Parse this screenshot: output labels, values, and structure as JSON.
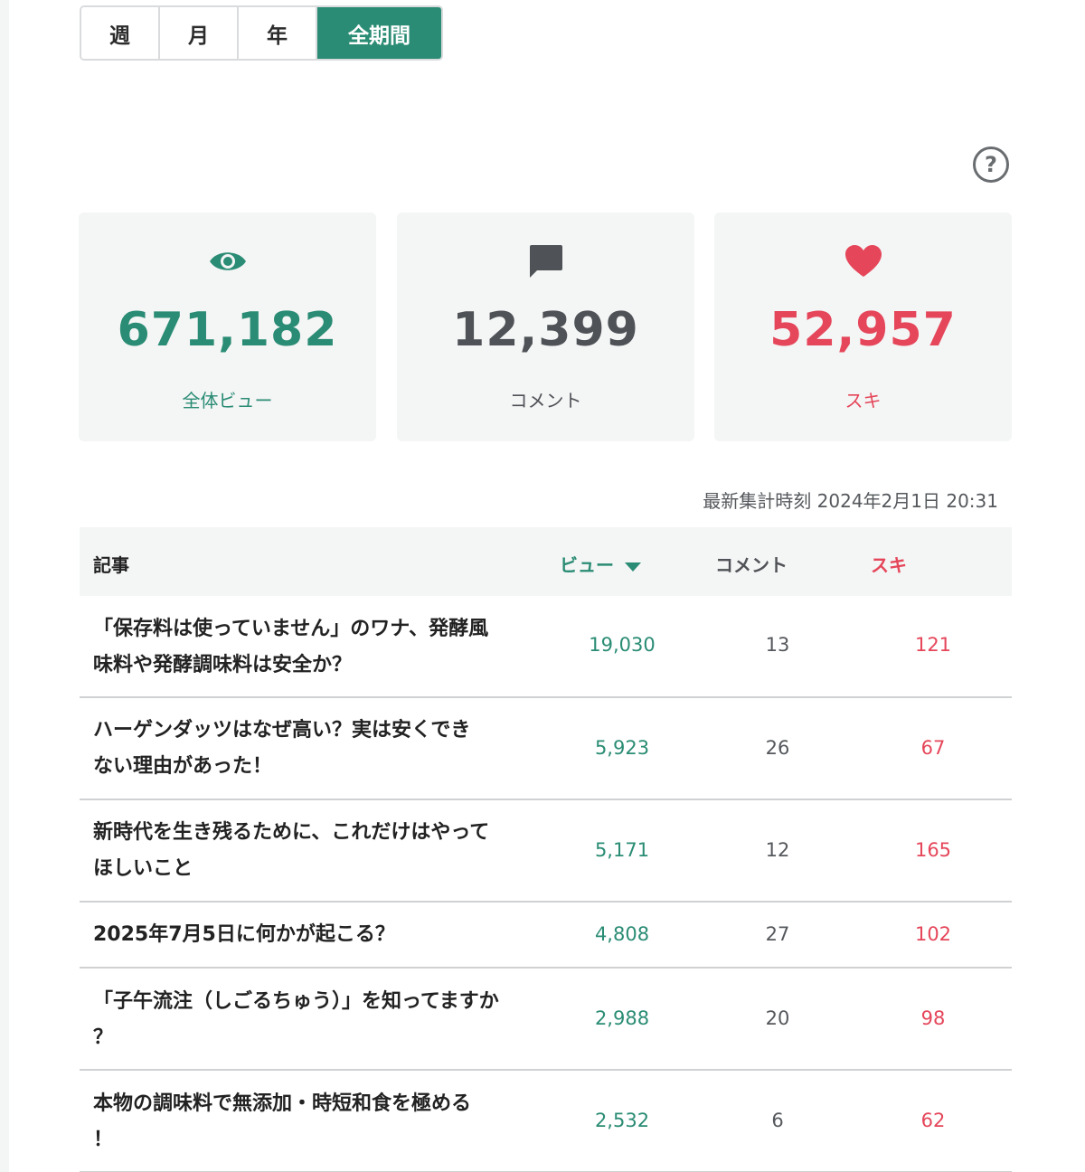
{
  "tabs": [
    {
      "label": "週"
    },
    {
      "label": "月"
    },
    {
      "label": "年"
    },
    {
      "label": "全期間",
      "active": true
    }
  ],
  "help_icon": "question-circle-icon",
  "stats": {
    "views": {
      "icon": "eye-icon",
      "value": "671,182",
      "label": "全体ビュー",
      "color": "#2a8c74"
    },
    "comments": {
      "icon": "comment-icon",
      "value": "12,399",
      "label": "コメント",
      "color": "#4f5256"
    },
    "likes": {
      "icon": "heart-icon",
      "value": "52,957",
      "label": "スキ",
      "color": "#e5465a"
    }
  },
  "updated_at": "最新集計時刻 2024年2月1日 20:31",
  "table": {
    "headers": {
      "article": "記事",
      "views": "ビュー",
      "comments": "コメント",
      "likes": "スキ"
    },
    "rows": [
      {
        "title_line1": "「保存料は使っていません」のワナ、発酵風",
        "title_line2": "味料や発酵調味料は安全か？",
        "views": "19,030",
        "comments": "13",
        "likes": "121"
      },
      {
        "title_line1": "ハーゲンダッツはなぜ高い？実は安くでき",
        "title_line2": "ない理由があった！",
        "views": "5,923",
        "comments": "26",
        "likes": "67"
      },
      {
        "title_line1": "新時代を生き残るために、これだけはやって",
        "title_line2": "ほしいこと",
        "views": "5,171",
        "comments": "12",
        "likes": "165"
      },
      {
        "title_line1": "2025年7月5日に何かが起こる？",
        "title_line2": "",
        "views": "4,808",
        "comments": "27",
        "likes": "102"
      },
      {
        "title_line1": "「子午流注（しごるちゅう）」を知ってますか",
        "title_line2": "？",
        "views": "2,988",
        "comments": "20",
        "likes": "98"
      },
      {
        "title_line1": "本物の調味料で無添加・時短和食を極める",
        "title_line2": "！",
        "views": "2,532",
        "comments": "6",
        "likes": "62"
      }
    ]
  }
}
